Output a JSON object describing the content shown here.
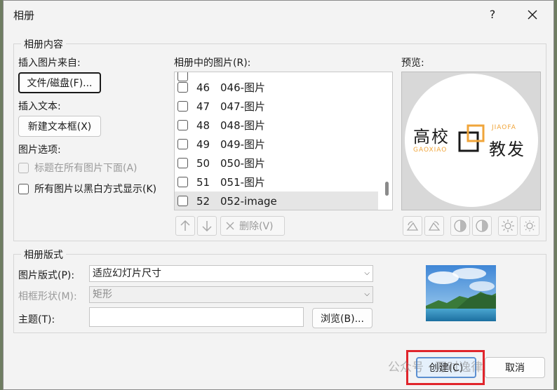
{
  "window": {
    "title": "相册",
    "help_label": "?"
  },
  "album_content": {
    "title": "相册内容",
    "insert_from_label": "插入图片来自:",
    "file_disk_button": "文件/磁盘(F)...",
    "insert_text_label": "插入文本:",
    "new_textbox_button": "新建文本框(X)",
    "picture_options_label": "图片选项:",
    "caption_below_label": "标题在所有图片下面(A)",
    "black_white_label": "所有图片以黑白方式显示(K)"
  },
  "pictures_list": {
    "label": "相册中的图片(R):",
    "items": [
      {
        "num": "46",
        "name": "046-图片",
        "selected": false
      },
      {
        "num": "47",
        "name": "047-图片",
        "selected": false
      },
      {
        "num": "48",
        "name": "048-图片",
        "selected": false
      },
      {
        "num": "49",
        "name": "049-图片",
        "selected": false
      },
      {
        "num": "50",
        "name": "050-图片",
        "selected": false
      },
      {
        "num": "51",
        "name": "051-图片",
        "selected": false
      },
      {
        "num": "52",
        "name": "052-image",
        "selected": true
      }
    ],
    "delete_button": "删除(V)"
  },
  "preview": {
    "label": "预览:",
    "logo_cn_top": "高校",
    "logo_cn_bottom": "教发",
    "logo_en_left": "GAOXIAO",
    "logo_en_right": "JIAOFA"
  },
  "album_layout": {
    "title": "相册版式",
    "picture_layout_label": "图片版式(P):",
    "picture_layout_value": "适应幻灯片尺寸",
    "frame_shape_label": "相框形状(M):",
    "frame_shape_value": "矩形",
    "theme_label": "主题(T):",
    "theme_value": "",
    "browse_button": "浏览(B)..."
  },
  "footer": {
    "create_button": "创建(C)",
    "cancel_button": "取消",
    "watermark": "公众号 · 万时逸律"
  },
  "colors": {
    "highlight": "#e0252c",
    "focus_border": "#5b8fd1",
    "logo_orange": "#f0a53a"
  }
}
